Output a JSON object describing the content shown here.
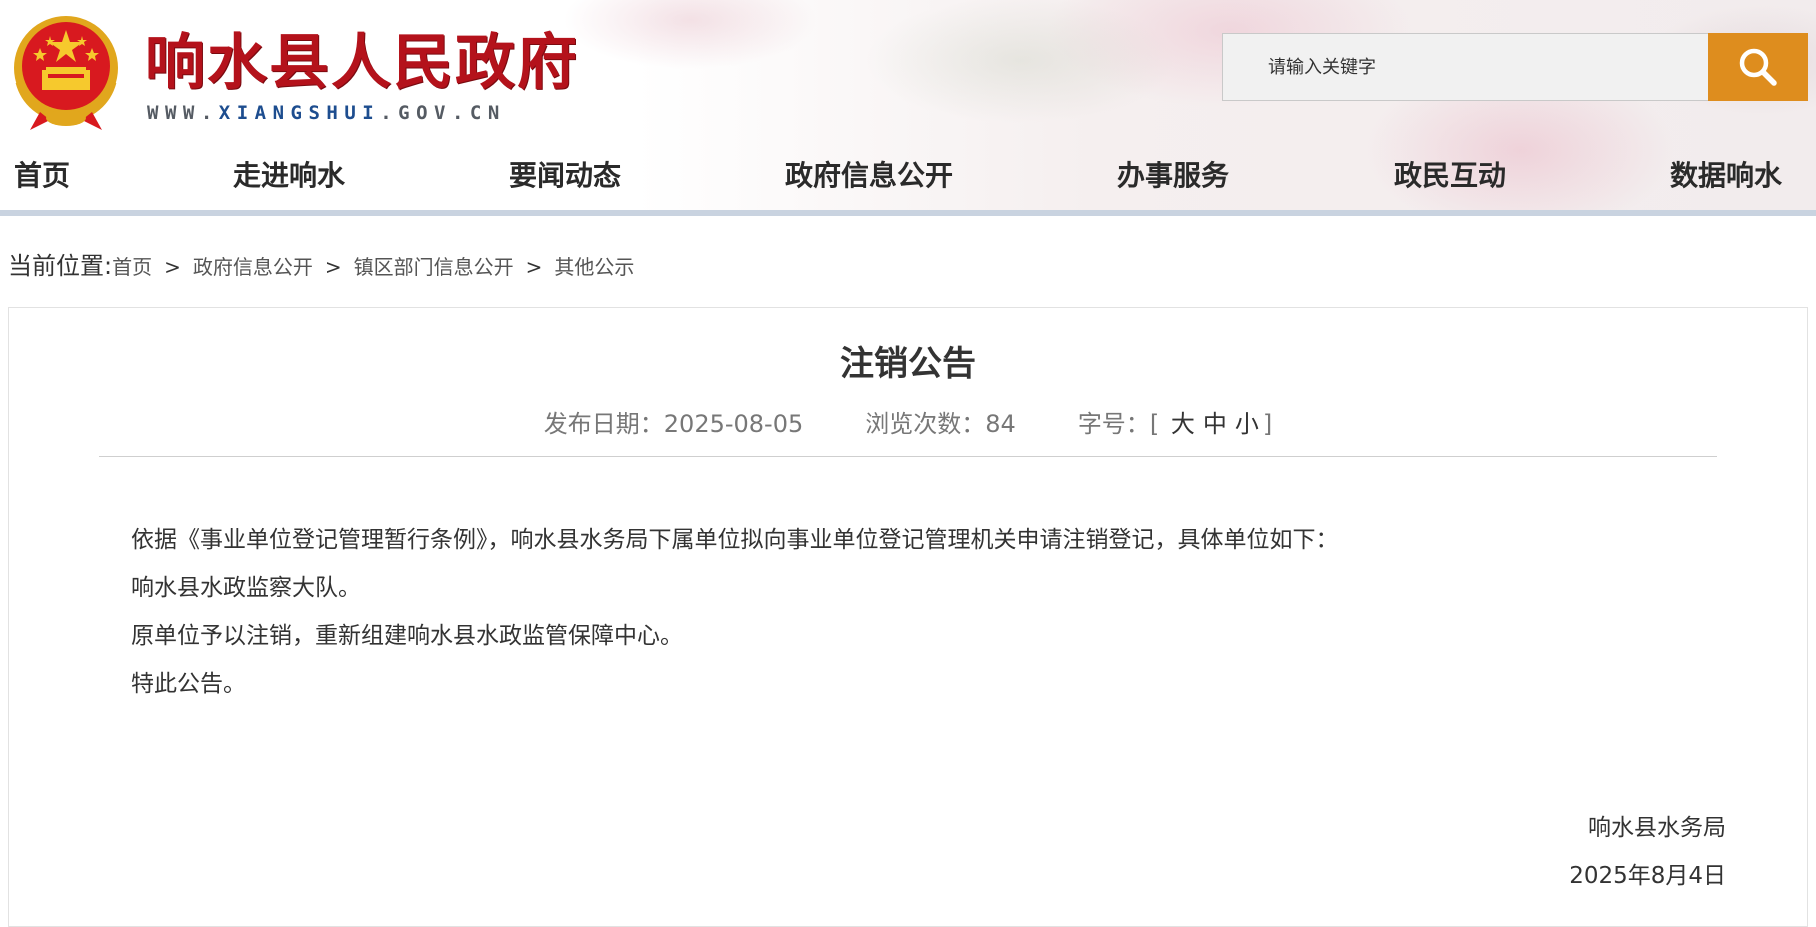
{
  "header": {
    "title": "响水县人民政府",
    "url_prefix": "WWW.",
    "url_name": "XIANGSHUI",
    "url_suffix": ".GOV.CN",
    "emblem_icon": "national-emblem-icon"
  },
  "search": {
    "placeholder": "请输入关键字",
    "button_icon": "search-icon",
    "button_color": "#de8d1e"
  },
  "nav": {
    "items": [
      {
        "label": "首页"
      },
      {
        "label": "走进响水"
      },
      {
        "label": "要闻动态"
      },
      {
        "label": "政府信息公开"
      },
      {
        "label": "办事服务"
      },
      {
        "label": "政民互动"
      },
      {
        "label": "数据响水"
      }
    ]
  },
  "breadcrumb": {
    "label": "当前位置:",
    "items": [
      "首页",
      "政府信息公开",
      "镇区部门信息公开",
      "其他公示"
    ],
    "separator": ">"
  },
  "article": {
    "title": "注销公告",
    "date_label": "发布日期：",
    "date": "2025-08-05",
    "views_label": "浏览次数：",
    "views": "84",
    "font_label": "字号：",
    "font_open": "[",
    "font_large": "大",
    "font_medium": "中",
    "font_small": "小",
    "font_close": "]",
    "paragraphs": [
      "依据《事业单位登记管理暂行条例》，响水县水务局下属单位拟向事业单位登记管理机关申请注销登记，具体单位如下：",
      "响水县水政监察大队。",
      "原单位予以注销，重新组建响水县水政监管保障中心。",
      "特此公告。"
    ],
    "signature_org": "响水县水务局",
    "signature_date": "2025年8月4日"
  },
  "colors": {
    "title_red": "#b4121b",
    "nav_rule": "#c9d3e0",
    "url_blue": "#1d4d8f"
  }
}
